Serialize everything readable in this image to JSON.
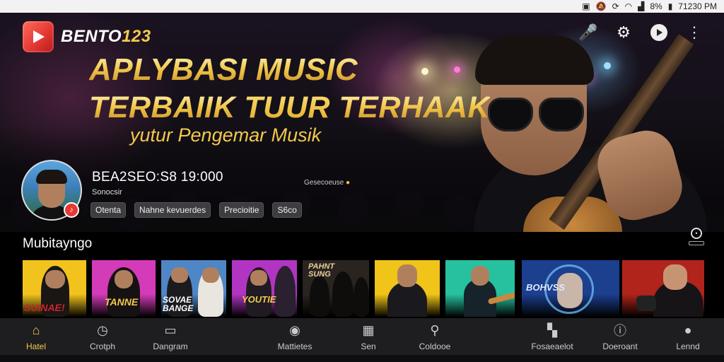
{
  "status_bar": {
    "time": "71230 PM",
    "battery": "8%",
    "icons": [
      "screenshot-icon",
      "mute-icon",
      "wifi-icon",
      "signal-icon",
      "battery-icon"
    ]
  },
  "brand": {
    "name_part1": "BENTO",
    "name_part2": "123",
    "accent_color": "#f2c94c",
    "logo_color": "#e53935"
  },
  "hero": {
    "headline_line1": "APLYBASI MUSIC",
    "headline_line2_a": "TERBAIIK ",
    "headline_line2_b": "TUUR",
    "headline_line2_c": " TERHAAK",
    "subtitle": "yutur Pengemar Musik"
  },
  "top_icons": [
    "microphone-icon",
    "settings-gear-icon",
    "play-circle-icon",
    "more-options-icon"
  ],
  "profile": {
    "name": "BEA2SEO:S8 19:000",
    "subtitle": "Sonocsir",
    "tags": [
      "Otenta",
      "Nahne kevuerdes",
      "Precioitie",
      "S6co"
    ],
    "live_text": "Gesecoeuse"
  },
  "section": {
    "title": "Mubitayngo"
  },
  "albums": [
    {
      "title": "SUINAE!",
      "bg": "#f2c31c"
    },
    {
      "title": "TANNE",
      "bg": "#d33bb8"
    },
    {
      "title": "SOVAE BANGE",
      "bg": "#4f86c6"
    },
    {
      "title": "YOUTIE",
      "bg": "#b234c2"
    },
    {
      "title": "PAHNT SUNG",
      "bg": "#2a2420"
    },
    {
      "title": "",
      "bg": "#f0c419"
    },
    {
      "title": "",
      "bg": "#27c1a0"
    },
    {
      "title": "BOHVSS",
      "bg": "#1c3f8e"
    },
    {
      "title": "",
      "bg": "#b0241c"
    }
  ],
  "bottom_nav": [
    {
      "label": "Hatel",
      "icon": "home-icon",
      "active": true
    },
    {
      "label": "Crotph",
      "icon": "clock-icon",
      "active": false
    },
    {
      "label": "Dangram",
      "icon": "image-icon",
      "active": false
    },
    {
      "label": "Mattietes",
      "icon": "mic-icon",
      "active": false
    },
    {
      "label": "Sen",
      "icon": "grid-icon",
      "active": false
    },
    {
      "label": "Coldooe",
      "icon": "search-icon",
      "active": false
    },
    {
      "label": "Fosaeaelot",
      "icon": "chart-icon",
      "active": false
    },
    {
      "label": "Doeroant",
      "icon": "info-circle-icon",
      "active": false
    },
    {
      "label": "Lennd",
      "icon": "user-icon",
      "active": false
    }
  ]
}
